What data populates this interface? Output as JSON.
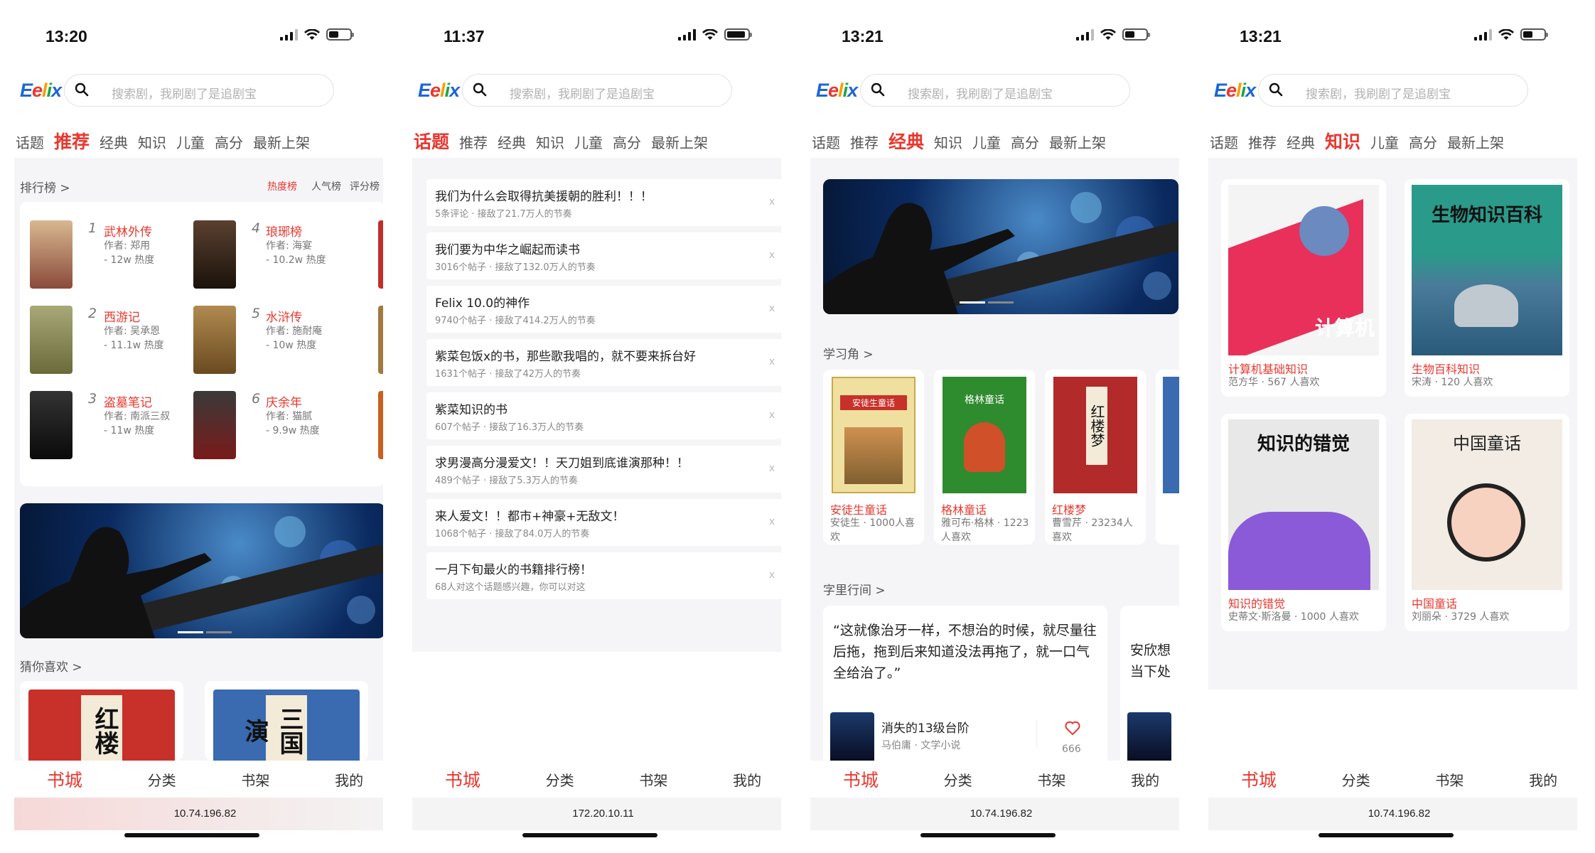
{
  "phones": [
    {
      "time": "13:20",
      "url": "10.74.196.82"
    },
    {
      "time": "11:37",
      "url": "172.20.10.11"
    },
    {
      "time": "13:21",
      "url": "10.74.196.82"
    },
    {
      "time": "13:21",
      "url": "10.74.196.82"
    }
  ],
  "logo": [
    "E",
    "e",
    "l",
    "i",
    "x"
  ],
  "search_placeholder": "搜索剧，我刷剧了是追剧宝",
  "tabs": [
    "话题",
    "推荐",
    "经典",
    "知识",
    "儿童",
    "高分",
    "最新上架"
  ],
  "bottom_nav": [
    "书城",
    "分类",
    "书架",
    "我的"
  ],
  "recommend": {
    "ranking_title": "排行榜 >",
    "ranking_tabs": [
      "热度榜",
      "人气榜",
      "评分榜"
    ],
    "rankings": [
      {
        "rank": "1",
        "title": "武林外传",
        "author": "作者: 郑用",
        "heat": "- 12w 热度",
        "color": "#c8a07a"
      },
      {
        "rank": "2",
        "title": "西游记",
        "author": "作者: 吴承恩",
        "heat": "- 11.1w 热度",
        "color": "#8a8a55"
      },
      {
        "rank": "3",
        "title": "盗墓笔记",
        "author": "作者: 南派三叔",
        "heat": "- 11w 热度",
        "color": "#1c1c1c"
      },
      {
        "rank": "4",
        "title": "琅琊榜",
        "author": "作者: 海宴",
        "heat": "- 10.2w 热度",
        "color": "#3a2a20"
      },
      {
        "rank": "5",
        "title": "水浒传",
        "author": "作者: 施耐庵",
        "heat": "- 10w 热度",
        "color": "#8a6a3a"
      },
      {
        "rank": "6",
        "title": "庆余年",
        "author": "作者: 猫腻",
        "heat": "- 9.9w 热度",
        "color": "#2a2a2a"
      }
    ],
    "guess_title": "猜你喜欢 >",
    "guess_covers": [
      {
        "text": "红楼",
        "color": "#c8302a"
      },
      {
        "text": "三国演",
        "color": "#3a6ab0"
      }
    ]
  },
  "topics": [
    {
      "title": "我们为什么会取得抗美援朝的胜利！！！",
      "sub": "5条评论 · 接敌了21.7万人的节奏"
    },
    {
      "title": "我们要为中华之崛起而读书",
      "sub": "3016个帖子 · 接敌了132.0万人的节奏"
    },
    {
      "title": "Felix 10.0的神作",
      "sub": "9740个帖子 · 接敌了414.2万人的节奏"
    },
    {
      "title": "紫菜包饭x的书，那些歌我唱的，就不要来拆台好",
      "sub": "1631个帖子 · 接敌了42万人的节奏"
    },
    {
      "title": "紫菜知识的书",
      "sub": "607个帖子 · 接敌了16.3万人的节奏"
    },
    {
      "title": "求男漫高分漫爱文！！天刀姐到底谁演那种！！",
      "sub": "489个帖子 · 接敌了5.3万人的节奏"
    },
    {
      "title": "来人爱文！！都市+神豪+无敌文！",
      "sub": "1068个帖子 · 接敌了84.0万人的节奏"
    },
    {
      "title": "一月下旬最火的书籍排行榜！",
      "sub": "68人对这个话题感兴趣，你可以对这"
    }
  ],
  "topic_close": "x",
  "classic": {
    "study_title": "学习角 >",
    "books": [
      {
        "title": "安徒生童话",
        "sub": "安徒生 · 1000人喜欢",
        "cover_text": "安徒生童话",
        "color": "#efe0a0"
      },
      {
        "title": "格林童话",
        "sub": "雅可布·格林 · 1223人喜欢",
        "cover_text": "格林童话",
        "color": "#2e8b2e"
      },
      {
        "title": "红楼梦",
        "sub": "曹雪芹 · 23234人喜欢",
        "cover_text": "红楼梦",
        "color": "#b22a2a"
      }
    ],
    "quotes_title": "字里行间 >",
    "quote": "“这就像治牙一样，不想治的时候，就尽量往后拖，拖到后来知道没法再拖了，就一口气全给治了。”",
    "quote_book": "消失的13级台阶",
    "quote_author": "马伯庸 · 文学小说",
    "quote_likes": "666",
    "quote2_partial": "安欣想当下处"
  },
  "knowledge": {
    "books": [
      {
        "title": "计算机基础知识",
        "sub": "范方华 · 567 人喜欢",
        "cover_text": "计算机",
        "color": "#e8305a"
      },
      {
        "title": "生物百科知识",
        "sub": "宋涛 · 120 人喜欢",
        "cover_text": "生物知识百科",
        "color": "#2a9a8a"
      },
      {
        "title": "知识的错觉",
        "sub": "史蒂文·斯洛曼 · 1000 人喜欢",
        "cover_text": "知识的错觉",
        "color": "#8a5ad8"
      },
      {
        "title": "中国童话",
        "sub": "刘丽朵 · 3729 人喜欢",
        "cover_text": "中国童话",
        "color": "#f2ece4"
      }
    ]
  }
}
